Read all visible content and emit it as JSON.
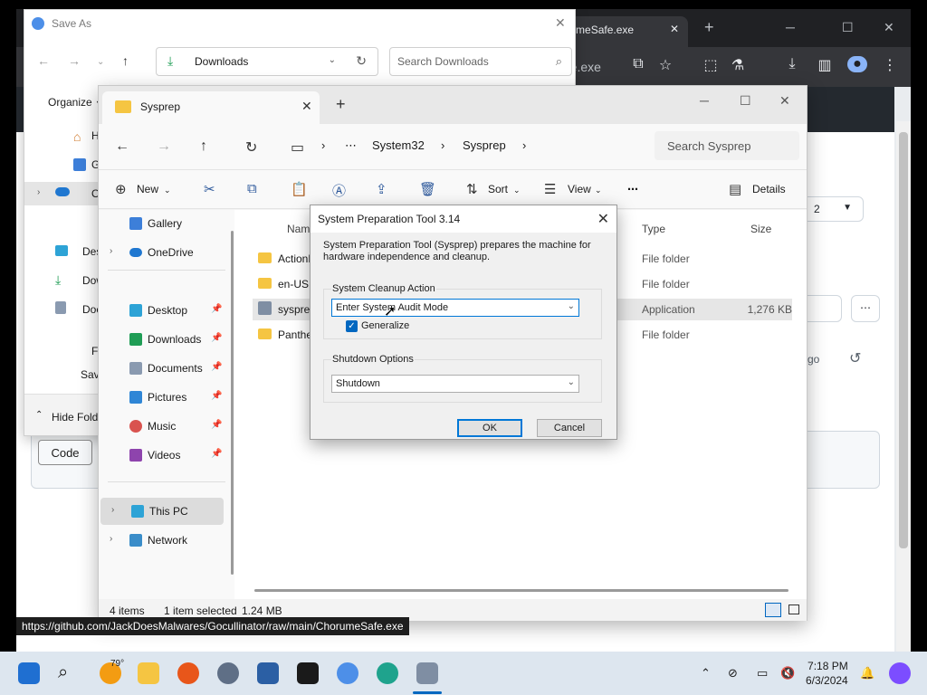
{
  "browser": {
    "tab_title": "/ChorumeSafe.exe",
    "omnibox_fragment": "afe.exe",
    "status_url": "https://github.com/JackDoesMalwares/Gocullinator/raw/main/ChorumeSafe.exe",
    "page_fragments": {
      "badge_count": "2",
      "time_ago": "s ago",
      "code_button": "Code"
    }
  },
  "saveas": {
    "title": "Save As",
    "address": "Downloads",
    "search_placeholder": "Search Downloads",
    "organize": "Organize",
    "side": [
      "Hom",
      "Galle",
      "OneD",
      "Desk",
      "Dow",
      "Docu"
    ],
    "file_label": "File",
    "save_label": "Save",
    "hide_folders": "Hide Fold"
  },
  "explorer": {
    "tab_title": "Sysprep",
    "breadcrumb": [
      "System32",
      "Sysprep"
    ],
    "search_placeholder": "Search Sysprep",
    "commands": {
      "new": "New",
      "sort": "Sort",
      "view": "View",
      "details": "Details"
    },
    "nav": {
      "gallery": "Gallery",
      "onedrive": "OneDrive",
      "desktop": "Desktop",
      "downloads": "Downloads",
      "documents": "Documents",
      "pictures": "Pictures",
      "music": "Music",
      "videos": "Videos",
      "this_pc": "This PC",
      "network": "Network"
    },
    "columns": {
      "name": "Name",
      "type": "Type",
      "size": "Size"
    },
    "rows": [
      {
        "name": "ActionF",
        "type": "File folder",
        "size": ""
      },
      {
        "name": "en-US",
        "type": "File folder",
        "size": ""
      },
      {
        "name": "sysprep",
        "type": "Application",
        "size": "1,276 KB"
      },
      {
        "name": "Panthe",
        "type": "File folder",
        "size": ""
      }
    ],
    "status": {
      "items": "4 items",
      "selected": "1 item selected",
      "size": "1.24 MB"
    }
  },
  "sysprep": {
    "title": "System Preparation Tool 3.14",
    "description": "System Preparation Tool (Sysprep) prepares the machine for hardware independence and cleanup.",
    "cleanup_group": "System Cleanup Action",
    "cleanup_value": "Enter System Audit Mode",
    "generalize": "Generalize",
    "shutdown_group": "Shutdown Options",
    "shutdown_value": "Shutdown",
    "ok": "OK",
    "cancel": "Cancel"
  },
  "taskbar": {
    "weather": "79°",
    "time": "7:18 PM",
    "date": "6/3/2024"
  },
  "colors": {
    "accent": "#0067c0",
    "folder": "#f5c542",
    "taskbar": "#dde6ef"
  }
}
